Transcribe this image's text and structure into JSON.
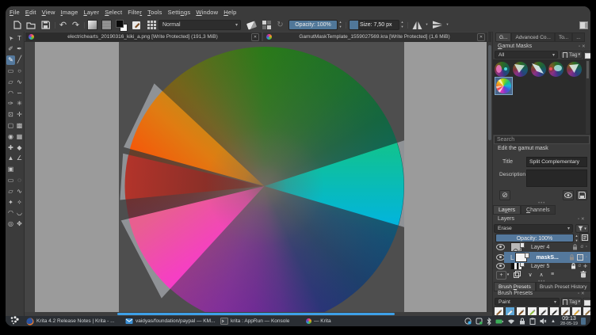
{
  "app": "Krita",
  "colors": {
    "accent_blue": "#3d9ae0",
    "slider_blue": "#507799",
    "selection_blue": "#54789c",
    "panel_bg": "#3b3b3b",
    "canvas_bg": "#454545",
    "document_gray": "#9b9b9b",
    "mask_square": "#4e4e4e",
    "taskbar_bg": "#2a2e33",
    "wedge_orange": "#f45d07",
    "wedge_red": "#b5342a",
    "wedge_pink": "#fb32d8",
    "wedge_teal": "#00b2e8"
  },
  "menu": {
    "items": [
      {
        "pre": "",
        "u": "F",
        "post": "ile"
      },
      {
        "pre": "",
        "u": "E",
        "post": "dit"
      },
      {
        "pre": "",
        "u": "V",
        "post": "iew"
      },
      {
        "pre": "",
        "u": "I",
        "post": "mage"
      },
      {
        "pre": "",
        "u": "L",
        "post": "ayer"
      },
      {
        "pre": "",
        "u": "S",
        "post": "elect"
      },
      {
        "pre": "Filte",
        "u": "r",
        "post": ""
      },
      {
        "pre": "",
        "u": "T",
        "post": "ools"
      },
      {
        "pre": "Setti",
        "u": "n",
        "post": "gs"
      },
      {
        "pre": "",
        "u": "W",
        "post": "indow"
      },
      {
        "pre": "",
        "u": "H",
        "post": "elp"
      }
    ]
  },
  "toolbar": {
    "undo_glyph": "↶",
    "redo_glyph": "↷",
    "blend_mode": "Normal",
    "opacity_label": "Opacity:  100%",
    "opacity_fill": 100,
    "size_label": "Size:  7,50 px",
    "size_fill": 17,
    "reload_glyph": "↻",
    "arrow": "▾"
  },
  "doc_tabs": [
    {
      "title": "electrichearts_20190316_kiki_a.png [Write Protected]  (191,3 MiB)",
      "close": "✕"
    },
    {
      "title": "GamutMaskTemplate_1559027569.kra [Write Protected]  (1,6 MiB)",
      "close": "✕"
    }
  ],
  "toolbox": {
    "tools": [
      {
        "id": "select-shapes",
        "g": "➤"
      },
      {
        "id": "text",
        "g": "T"
      },
      {
        "id": "edit-shapes",
        "g": "✐"
      },
      {
        "id": "calligraphy",
        "g": "✒"
      },
      {
        "id": "freehand-brush",
        "g": "✎",
        "sel": true
      },
      {
        "id": "line",
        "g": "╱"
      },
      {
        "id": "rectangle",
        "g": "▭"
      },
      {
        "id": "ellipse",
        "g": "○"
      },
      {
        "id": "polygon",
        "g": "▱"
      },
      {
        "id": "polyline",
        "g": "∿"
      },
      {
        "id": "bezier",
        "g": "◠"
      },
      {
        "id": "freehand-path",
        "g": "∽"
      },
      {
        "id": "dynamic-brush",
        "g": "✑"
      },
      {
        "id": "multibrush",
        "g": "✳︎"
      },
      {
        "id": "transform",
        "g": "⊡"
      },
      {
        "id": "move",
        "g": "✛"
      },
      {
        "id": "crop",
        "g": "▢"
      },
      {
        "id": "gradient",
        "g": "▩"
      },
      {
        "id": "color-sampler",
        "g": "◉"
      },
      {
        "id": "pattern",
        "g": "▦"
      },
      {
        "id": "smart-patch",
        "g": "✚"
      },
      {
        "id": "fill",
        "g": "◆"
      },
      {
        "id": "assistants",
        "g": "▲"
      },
      {
        "id": "measure",
        "g": "∠"
      },
      {
        "id": "reference",
        "g": "▣"
      },
      {
        "id": "spacer1",
        "g": ""
      },
      {
        "id": "rect-select",
        "g": "▭"
      },
      {
        "id": "ellipse-select",
        "g": "◌"
      },
      {
        "id": "poly-select",
        "g": "▱"
      },
      {
        "id": "freehand-select",
        "g": "∿"
      },
      {
        "id": "contiguous-select",
        "g": "✦"
      },
      {
        "id": "similar-select",
        "g": "✧"
      },
      {
        "id": "bezier-select",
        "g": "◠"
      },
      {
        "id": "magnetic-select",
        "g": "◡"
      },
      {
        "id": "zoom",
        "g": "◎"
      },
      {
        "id": "pan",
        "g": "✥"
      }
    ]
  },
  "panel": {
    "tabs": [
      {
        "label": "G...",
        "active": true
      },
      {
        "label": "Advanced Co...",
        "active": false
      },
      {
        "label": "To...",
        "active": false
      },
      {
        "label": "...",
        "active": false
      }
    ],
    "gamut": {
      "title_pre": "",
      "title_u": "G",
      "title_post": "amut Masks",
      "filter_all": "All",
      "tag_label": "Tag",
      "search_placeholder": "Search",
      "edit_heading": "Edit the gamut mask",
      "title_label": "Title",
      "title_value": "Split Complementary",
      "desc_label": "Description",
      "cancel_glyph": "⊘"
    },
    "layers": {
      "tab_layers_pre": "La",
      "tab_layers_u": "y",
      "tab_layers_post": "ers",
      "tab_channels_pre": "",
      "tab_channels_u": "C",
      "tab_channels_post": "hannels",
      "header": "Layers",
      "blend_mode": "Erase",
      "opacity_label": "Opacity:  100%",
      "rows": [
        {
          "name": "Layer 4",
          "alpha": "α",
          "bold": false
        },
        {
          "name": "maskS...",
          "alpha": "α",
          "bold": true
        },
        {
          "name": "Layer 5",
          "alpha": "α",
          "bold": false
        }
      ],
      "btn_add": "+",
      "btn_down": "∨",
      "btn_up": "∧",
      "btn_props": "≡"
    },
    "brush": {
      "tab1_pre": "Brush ",
      "tab1_u": "P",
      "tab1_post": "resets",
      "tab2": "Brush Preset History",
      "header": "Brush Presets",
      "filter": "Paint",
      "tag_label": "Tag"
    }
  },
  "taskbar": {
    "tasks": [
      {
        "id": "firefox",
        "text": "Krita 4.2 Release Notes | Krita - ..."
      },
      {
        "id": "kmail",
        "text": "vaidyas/foundation/paypal — KM..."
      },
      {
        "id": "konsole",
        "text": "krita : AppRun — Konsole"
      },
      {
        "id": "krita",
        "text": "— Krita"
      }
    ],
    "clock_time": "09:13",
    "clock_date": "28-05-19"
  }
}
